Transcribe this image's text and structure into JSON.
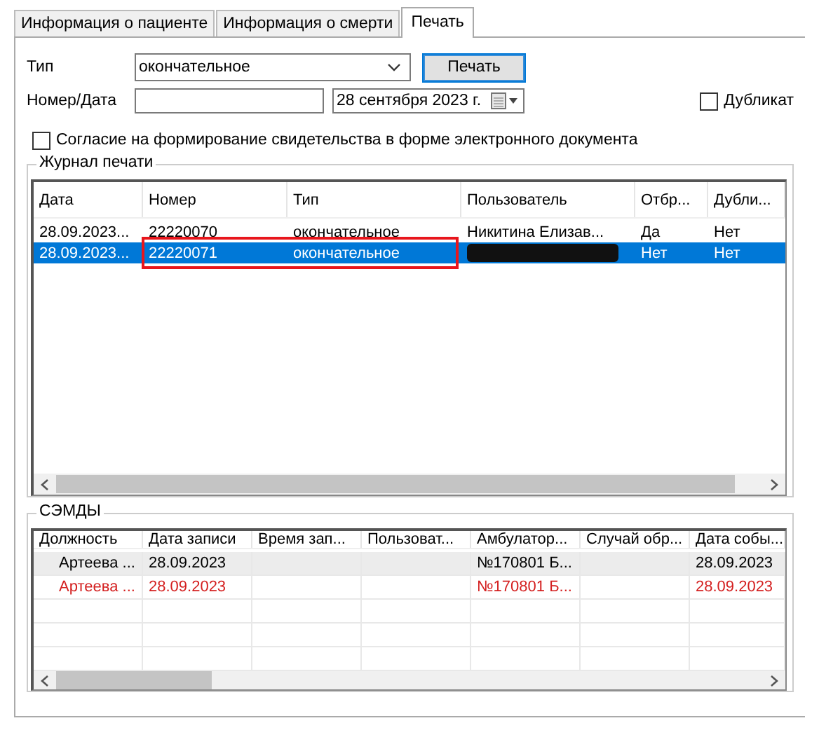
{
  "tabs": [
    {
      "label": "Информация о пациенте",
      "selected": false
    },
    {
      "label": "Информация о смерти",
      "selected": false
    },
    {
      "label": "Печать",
      "selected": true
    }
  ],
  "form": {
    "type_label": "Тип",
    "type_value": "окончательное",
    "print_button": "Печать",
    "number_label": "Номер/Дата",
    "date_value": "28 сентября 2023 г.",
    "duplicate": {
      "label": "Дубликат",
      "checked": false
    },
    "consent": {
      "label": "Согласие на формирование свидетельства в форме электронного документа",
      "checked": false
    }
  },
  "print_log": {
    "title": "Журнал печати",
    "columns": [
      "Дата",
      "Номер",
      "Тип",
      "Пользователь",
      "Отбр...",
      "Дубли..."
    ],
    "rows": [
      {
        "selected": false,
        "redacted": false,
        "cells": [
          "28.09.2023...",
          "22220070",
          "окончательное",
          "Никитина Елизав...",
          "Да",
          "Нет"
        ]
      },
      {
        "selected": true,
        "redacted": true,
        "cells": [
          "28.09.2023...",
          "22220071",
          "окончательное",
          "",
          "Нет",
          "Нет"
        ]
      }
    ]
  },
  "semd": {
    "title": "СЭМДЫ",
    "columns": [
      "Должность",
      "Дата записи",
      "Время зап...",
      "Пользоват...",
      "Амбулатор...",
      "Случай обр...",
      "Дата собы..."
    ],
    "rows": [
      {
        "selected": true,
        "color": "#000000",
        "cells": [
          "Артеева ...",
          "28.09.2023",
          "",
          "",
          "№170801 Б...",
          "",
          "28.09.2023"
        ]
      },
      {
        "selected": false,
        "color": "#d42020",
        "cells": [
          "Артеева ...",
          "28.09.2023",
          "",
          "",
          "№170801 Б...",
          "",
          "28.09.2023"
        ]
      }
    ]
  }
}
